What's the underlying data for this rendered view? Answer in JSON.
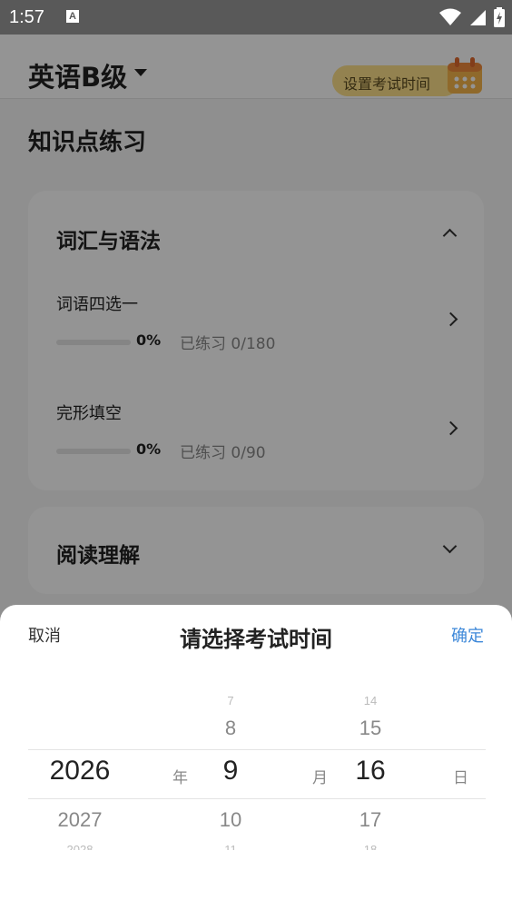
{
  "status_bar": {
    "time": "1:57",
    "notification_glyph": "A"
  },
  "header": {
    "subject": "英语B级",
    "exam_time_button": "设置考试时间"
  },
  "section_title": "知识点练习",
  "cards": [
    {
      "title": "词汇与语法",
      "expanded": true,
      "items": [
        {
          "title": "词语四选一",
          "progress_percent": 0,
          "progress_label": "0%",
          "practiced": "已练习 0/180"
        },
        {
          "title": "完形填空",
          "progress_percent": 0,
          "progress_label": "0%",
          "practiced": "已练习 0/90"
        }
      ]
    },
    {
      "title": "阅读理解",
      "expanded": false
    }
  ],
  "date_picker": {
    "cancel": "取消",
    "title": "请选择考试时间",
    "confirm": "确定",
    "year": {
      "far_above": "",
      "above": "",
      "selected": "2026",
      "below": "2027",
      "far_below": "2028",
      "unit": "年"
    },
    "month": {
      "far_above": "7",
      "above": "8",
      "selected": "9",
      "below": "10",
      "far_below": "11",
      "unit": "月"
    },
    "day": {
      "far_above": "14",
      "above": "15",
      "selected": "16",
      "below": "17",
      "far_below": "18",
      "unit": "日"
    }
  },
  "colors": {
    "accent_blue": "#3d88d9",
    "exam_button_bg": "#fde08a",
    "status_bar": "#595959"
  }
}
